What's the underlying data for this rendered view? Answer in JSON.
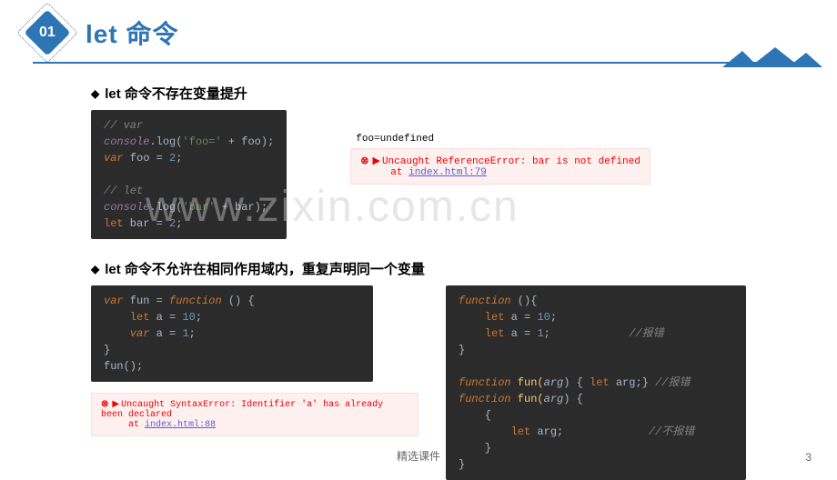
{
  "header": {
    "badge": "01",
    "title": "let 命令"
  },
  "sub1": {
    "prefix": "let ",
    "text": "命令不存在变量提升"
  },
  "code1": {
    "l1": "// var",
    "l2a": "console",
    "l2b": ".log(",
    "l2c": "'foo='",
    "l2d": " + foo);",
    "l3a": "var",
    "l3b": " foo = ",
    "l3c": "2",
    "l3d": ";",
    "l4": "",
    "l5": "// let",
    "l6a": "console",
    "l6b": ".log(",
    "l6c": "'bar'",
    "l6d": " + bar);",
    "l7a": "let",
    "l7b": " bar = ",
    "l7c": "2",
    "l7d": ";"
  },
  "out1": "foo=undefined",
  "err1": {
    "msg": "Uncaught ReferenceError: bar is not defined",
    "at": "at ",
    "link": "index.html:79"
  },
  "sub2": {
    "prefix": "let ",
    "text": "命令不允许在相同作用域内，重复声明同一个变量"
  },
  "code2": {
    "l1a": "var",
    "l1b": " fun = ",
    "l1c": "function",
    "l1d": " () {",
    "l2a": "    let",
    "l2b": " a = ",
    "l2c": "10",
    "l2d": ";",
    "l3a": "    var",
    "l3b": " a = ",
    "l3c": "1",
    "l3d": ";",
    "l4": "}",
    "l5": "fun();"
  },
  "err2": {
    "msg": "Uncaught SyntaxError: Identifier 'a' has already been declared",
    "at": "at ",
    "link": "index.html:88"
  },
  "code3": {
    "l1a": "function",
    "l1b": " (){",
    "l2a": "    let",
    "l2b": " a = ",
    "l2c": "10",
    "l2d": ";",
    "l3a": "    let",
    "l3b": " a = ",
    "l3c": "1",
    "l3d": ";",
    "l3cmt": "            //报错",
    "l4": "}",
    "l5": "",
    "l6a": "function",
    "l6b": " fun(",
    "l6c": "arg",
    "l6d": ") { ",
    "l6e": "let",
    "l6f": " arg;}",
    "l6cmt": " //报错",
    "l7a": "function",
    "l7b": " fun(",
    "l7c": "arg",
    "l7d": ") {",
    "l8": "    {",
    "l9a": "        let",
    "l9b": " arg;",
    "l9cmt": "             //不报错",
    "l10": "    }",
    "l11": "}"
  },
  "watermark": "www.zixin.com.cn",
  "footer": "精选课件",
  "page": "3"
}
